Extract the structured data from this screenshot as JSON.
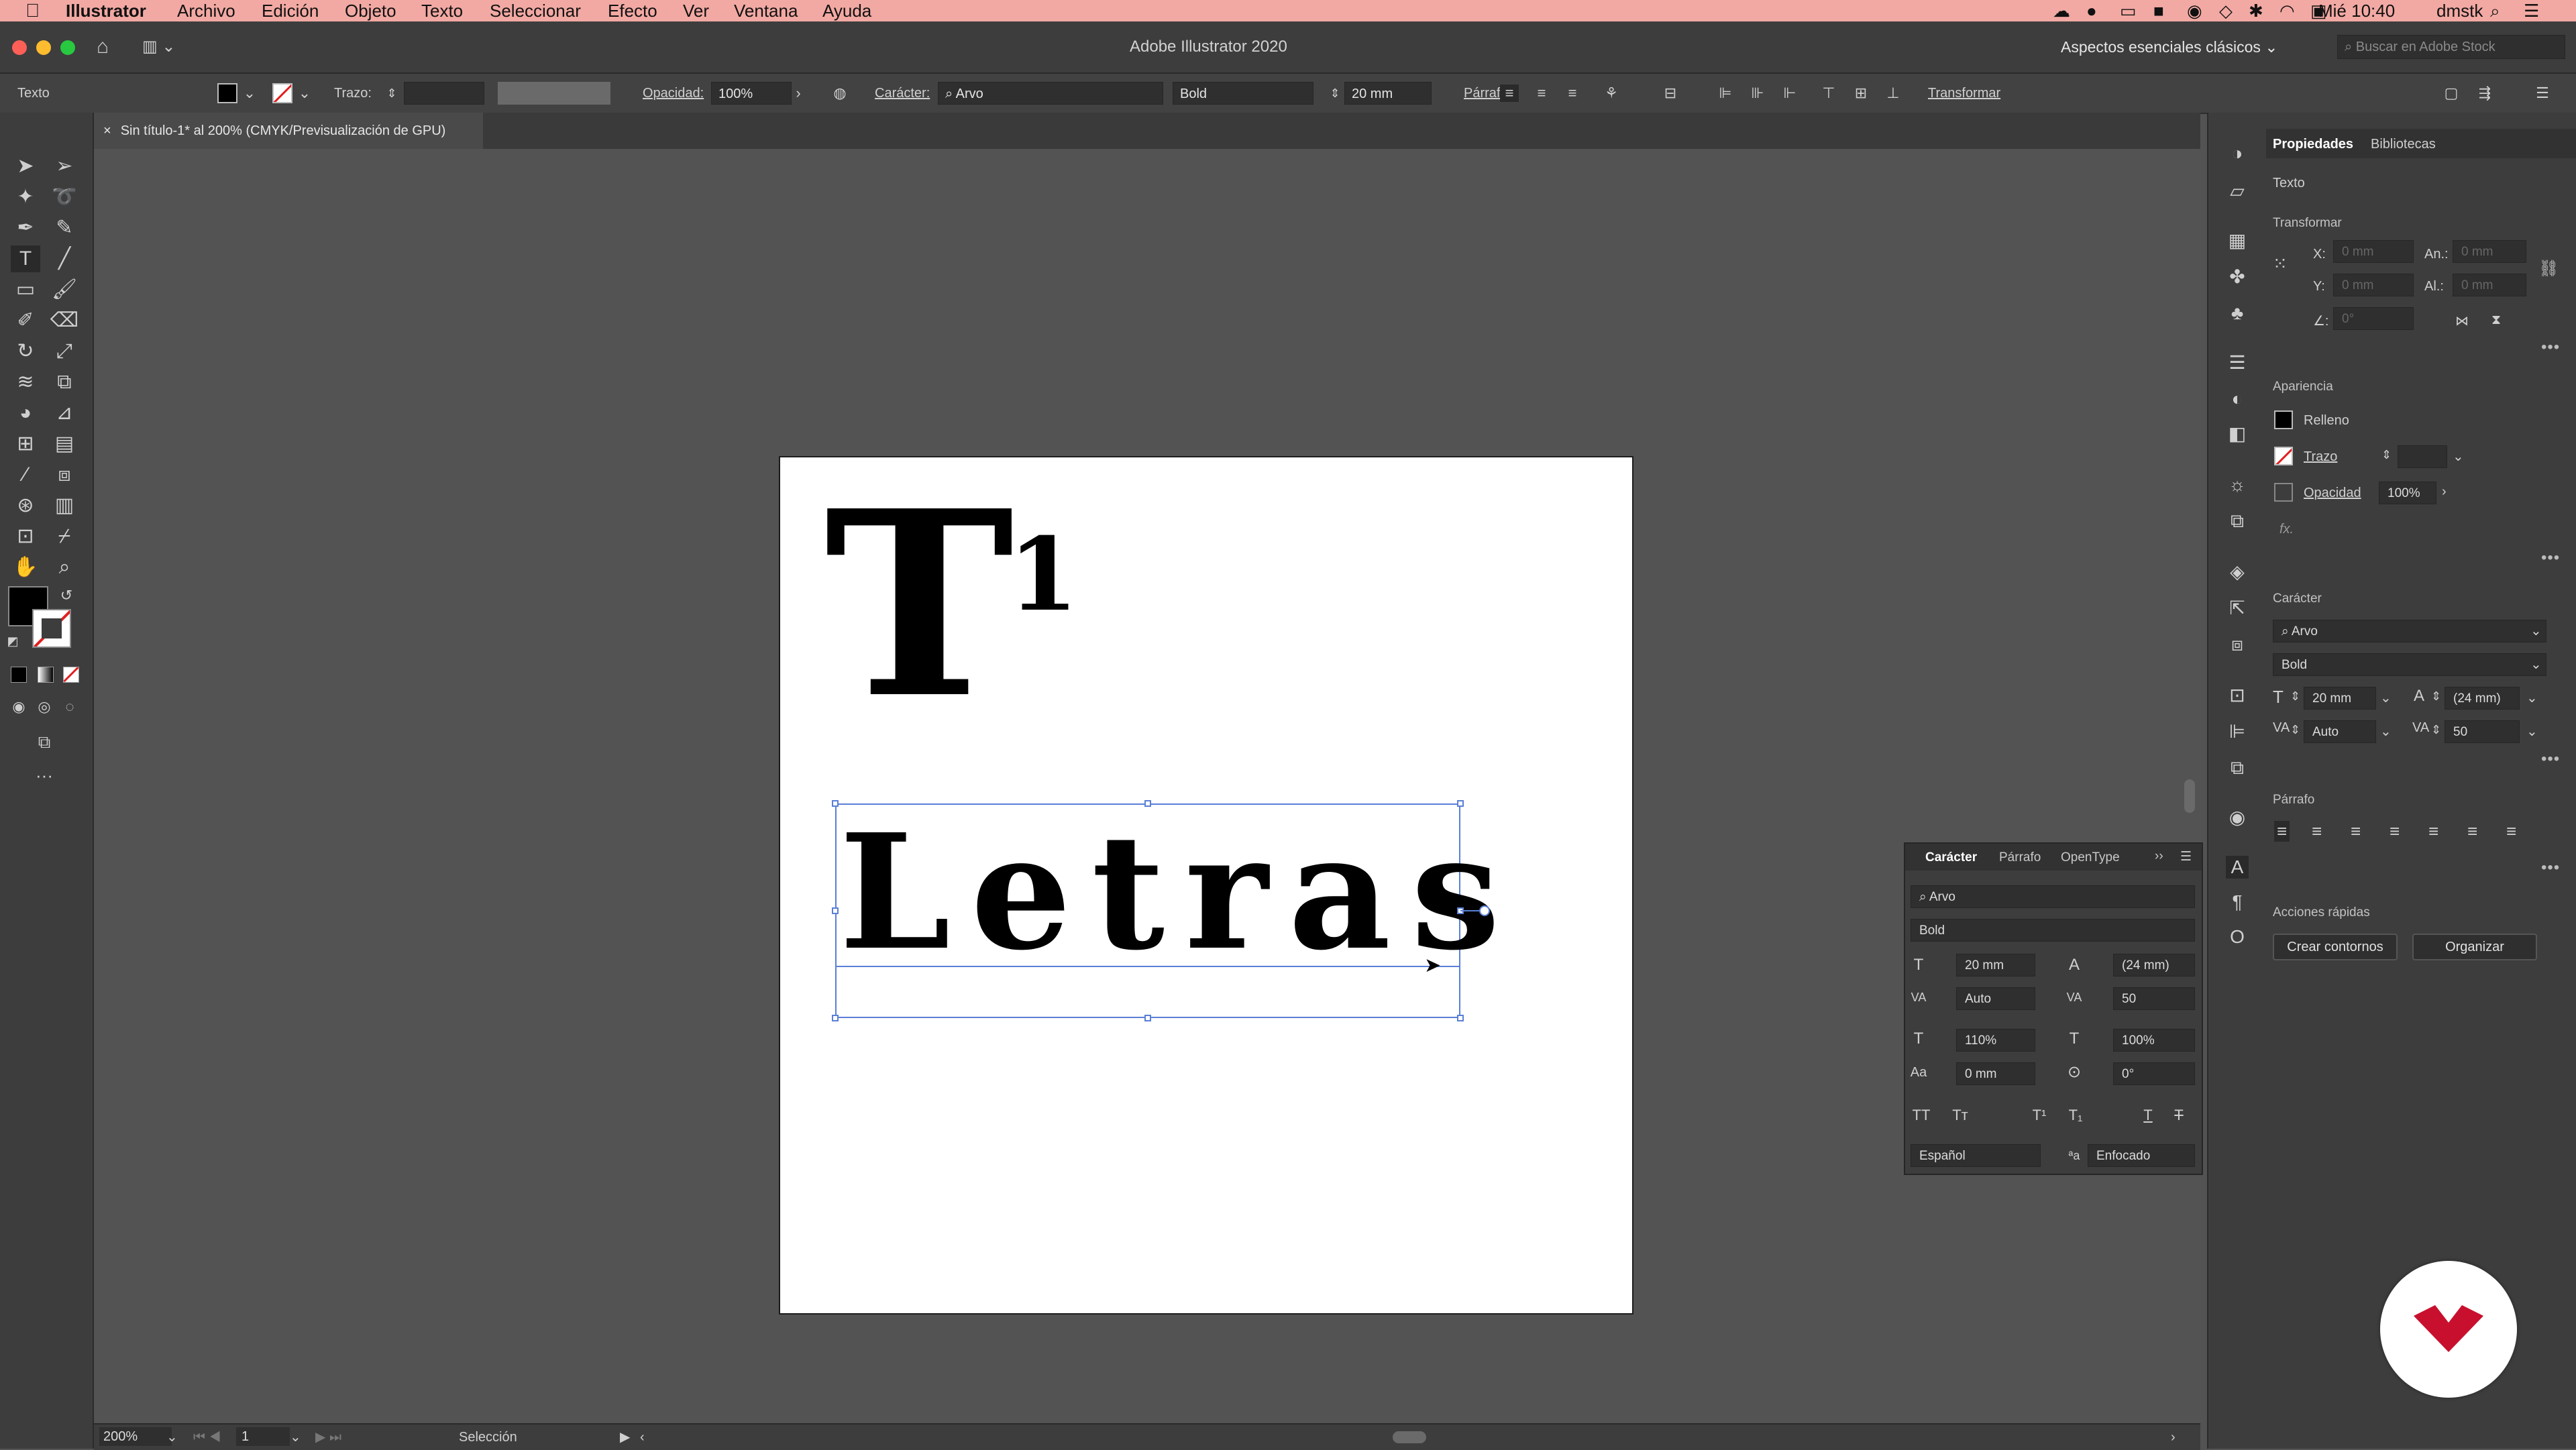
{
  "menubar": {
    "apple_icon": "apple-icon",
    "app_name": "Illustrator",
    "items": [
      "Archivo",
      "Edición",
      "Objeto",
      "Texto",
      "Seleccionar",
      "Efecto",
      "Ver",
      "Ventana",
      "Ayuda"
    ],
    "clock": "Mié 10:40",
    "user": "dmstk"
  },
  "titlebar": {
    "title": "Adobe Illustrator 2020",
    "workspace": "Aspectos esenciales clásicos",
    "search_placeholder": "Buscar en Adobe Stock"
  },
  "controlbar": {
    "selection_type": "Texto",
    "stroke_label": "Trazo:",
    "opacity_label": "Opacidad:",
    "opacity_value": "100%",
    "character_label": "Carácter:",
    "font_family": "Arvo",
    "font_style": "Bold",
    "font_size": "20 mm",
    "paragraph_label": "Párrafo:",
    "transform_label": "Transformar"
  },
  "document": {
    "tab_title": "Sin título-1* al 200% (CMYK/Previsualización de GPU)",
    "close_symbol": "×"
  },
  "artboard": {
    "big_letter": "T",
    "superscript": "1",
    "text_object": "Letras"
  },
  "statusbar": {
    "zoom": "200%",
    "artboard_number": "1",
    "status": "Selección"
  },
  "properties": {
    "tabs": [
      "Propiedades",
      "Bibliotecas"
    ],
    "object_type": "Texto",
    "transform_title": "Transformar",
    "x_label": "X:",
    "y_label": "Y:",
    "w_label": "An.:",
    "h_label": "Al.:",
    "angle_label": "∠:",
    "x_value": "0 mm",
    "y_value": "0 mm",
    "w_value": "0 mm",
    "h_value": "0 mm",
    "angle_value": "0°",
    "appearance_title": "Apariencia",
    "fill_label": "Relleno",
    "stroke_label": "Trazo",
    "opacity_label": "Opacidad",
    "opacity_value": "100%",
    "fx_label": "fx.",
    "character_title": "Carácter",
    "font_family": "Arvo",
    "font_style": "Bold",
    "font_size": "20 mm",
    "leading": "(24 mm)",
    "kerning": "Auto",
    "tracking": "50",
    "paragraph_title": "Párrafo",
    "quick_actions_title": "Acciones rápidas",
    "create_outlines": "Crear contornos",
    "arrange": "Organizar"
  },
  "char_panel": {
    "tabs": [
      "Carácter",
      "Párrafo",
      "OpenType"
    ],
    "font_family": "Arvo",
    "font_style": "Bold",
    "font_size": "20 mm",
    "leading": "(24 mm)",
    "kerning": "Auto",
    "tracking": "50",
    "vertical_scale": "110%",
    "horizontal_scale": "100%",
    "baseline_shift": "0 mm",
    "rotation": "0°",
    "language": "Español",
    "antialias": "Enfocado"
  },
  "colors": {
    "menubar_bg": "#f2a9a3",
    "selection_blue": "#5a7fd6",
    "logo_red": "#c8102e"
  }
}
